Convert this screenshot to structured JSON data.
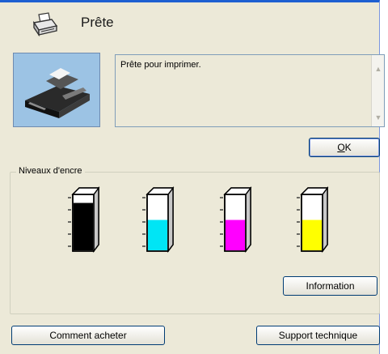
{
  "status": {
    "title": "Prête",
    "message": "Prête pour imprimer."
  },
  "buttons": {
    "ok_shortcut": "O",
    "ok_rest": "K",
    "information": "Information",
    "how_to_buy": "Comment acheter",
    "support": "Support technique"
  },
  "ink": {
    "group_label": "Niveaux d'encre",
    "cartridges": [
      {
        "name": "Black",
        "color": "#000000",
        "level": 0.85
      },
      {
        "name": "Cyan",
        "color": "#00e5f5",
        "level": 0.55
      },
      {
        "name": "Magenta",
        "color": "#ff00ff",
        "level": 0.55
      },
      {
        "name": "Yellow",
        "color": "#ffff00",
        "level": 0.55
      }
    ]
  },
  "icons": {
    "header": "printer-icon",
    "scroll_up": "scroll-up-arrow-icon",
    "scroll_down": "scroll-down-arrow-icon"
  }
}
